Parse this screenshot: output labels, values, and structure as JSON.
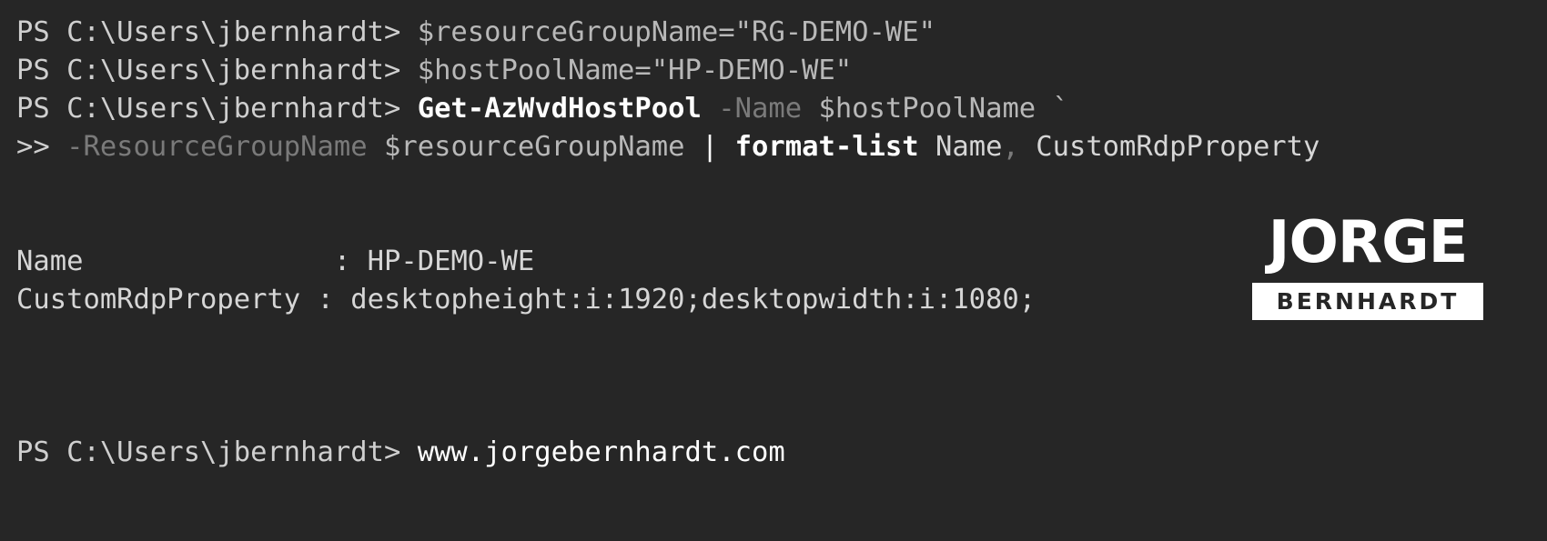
{
  "terminal": {
    "lines": [
      {
        "prompt": "PS C:\\Users\\jbernhardt> ",
        "tokens": [
          "$resourceGroupName",
          "=",
          "\"RG-DEMO-WE\""
        ]
      },
      {
        "prompt": "PS C:\\Users\\jbernhardt> ",
        "tokens": [
          "$hostPoolName",
          "=",
          "\"HP-DEMO-WE\""
        ]
      },
      {
        "prompt": "PS C:\\Users\\jbernhardt> ",
        "tokens": [
          "Get-AzWvdHostPool",
          " ",
          "-Name",
          " ",
          "$hostPoolName",
          " ",
          "`"
        ]
      },
      {
        "prompt": ">> ",
        "tokens": [
          "-ResourceGroupName",
          " ",
          "$resourceGroupName",
          " ",
          "|",
          " ",
          "format-list",
          " ",
          "Name",
          ",",
          " ",
          "CustomRdpProperty"
        ]
      }
    ],
    "output": [
      {
        "label": "Name              ",
        "sep": " : ",
        "value": "HP-DEMO-WE"
      },
      {
        "label": "CustomRdpProperty",
        "sep": " : ",
        "value": "desktopheight:i:1920;desktopwidth:i:1080;"
      }
    ],
    "final": {
      "prompt": "PS C:\\Users\\jbernhardt> ",
      "text": "www.jorgebernhardt.com"
    }
  },
  "logo": {
    "word": "JORGE",
    "subword": "BERNHARDT"
  },
  "colors": {
    "background": "#262626",
    "text": "#cfcfcf",
    "command": "#ffffff",
    "parameter": "#7a7a7a"
  }
}
